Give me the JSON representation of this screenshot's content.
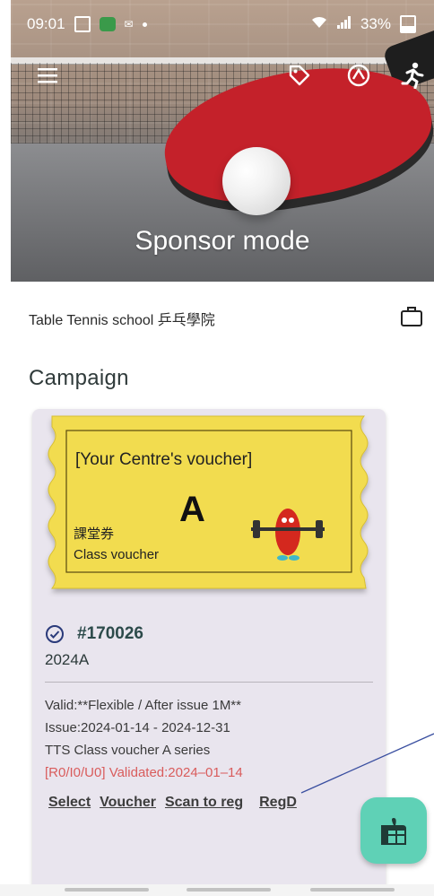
{
  "status_bar": {
    "time": "09:01",
    "battery": "33%"
  },
  "hero": {
    "title": "Sponsor mode"
  },
  "toolbar": {
    "icons": [
      "menu-icon",
      "tag-icon",
      "badge-icon",
      "runner-icon"
    ]
  },
  "shop": {
    "name": "Table Tennis school 乒乓學院"
  },
  "section": {
    "title": "Campaign"
  },
  "voucher": {
    "header": "[Your Centre's voucher]",
    "letter": "A",
    "label_zh": "課堂券",
    "label_en": "Class voucher"
  },
  "card": {
    "id": "#170026",
    "year": "2024A",
    "valid": "Valid:**Flexible / After issue 1M**",
    "issue": "Issue:2024-01-14 - 2024-12-31",
    "series": "TTS Class voucher A series",
    "status": "[R0/I0/U0] Validated:2024–01–14",
    "actions": [
      "Select",
      "Voucher",
      "Scan to reg",
      "RegD"
    ]
  },
  "colors": {
    "accent": "#5fd1b6",
    "voucher_yellow": "#f2dc4f",
    "status_red": "#d95c5c"
  }
}
